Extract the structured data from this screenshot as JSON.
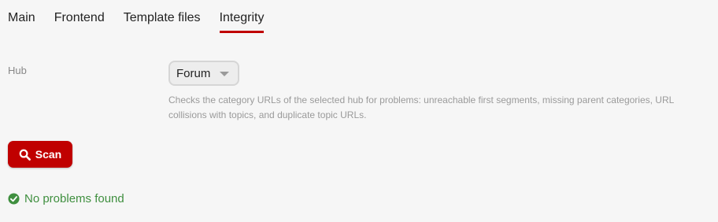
{
  "tabs": [
    {
      "label": "Main",
      "active": false
    },
    {
      "label": "Frontend",
      "active": false
    },
    {
      "label": "Template files",
      "active": false
    },
    {
      "label": "Integrity",
      "active": true
    }
  ],
  "form": {
    "hub_label": "Hub",
    "hub_selected": "Forum",
    "hub_hint": "Checks the category URLs of the selected hub for problems: unreachable first segments, missing parent categories, URL collisions with topics, and duplicate topic URLs."
  },
  "scan_button": {
    "label": "Scan",
    "icon": "search-icon"
  },
  "status": {
    "text": "No problems found",
    "icon": "check-circle-icon"
  },
  "colors": {
    "accent": "#c00000",
    "success": "#3f8f3f",
    "background": "#f6f6f6",
    "muted": "#9a9a9a"
  }
}
